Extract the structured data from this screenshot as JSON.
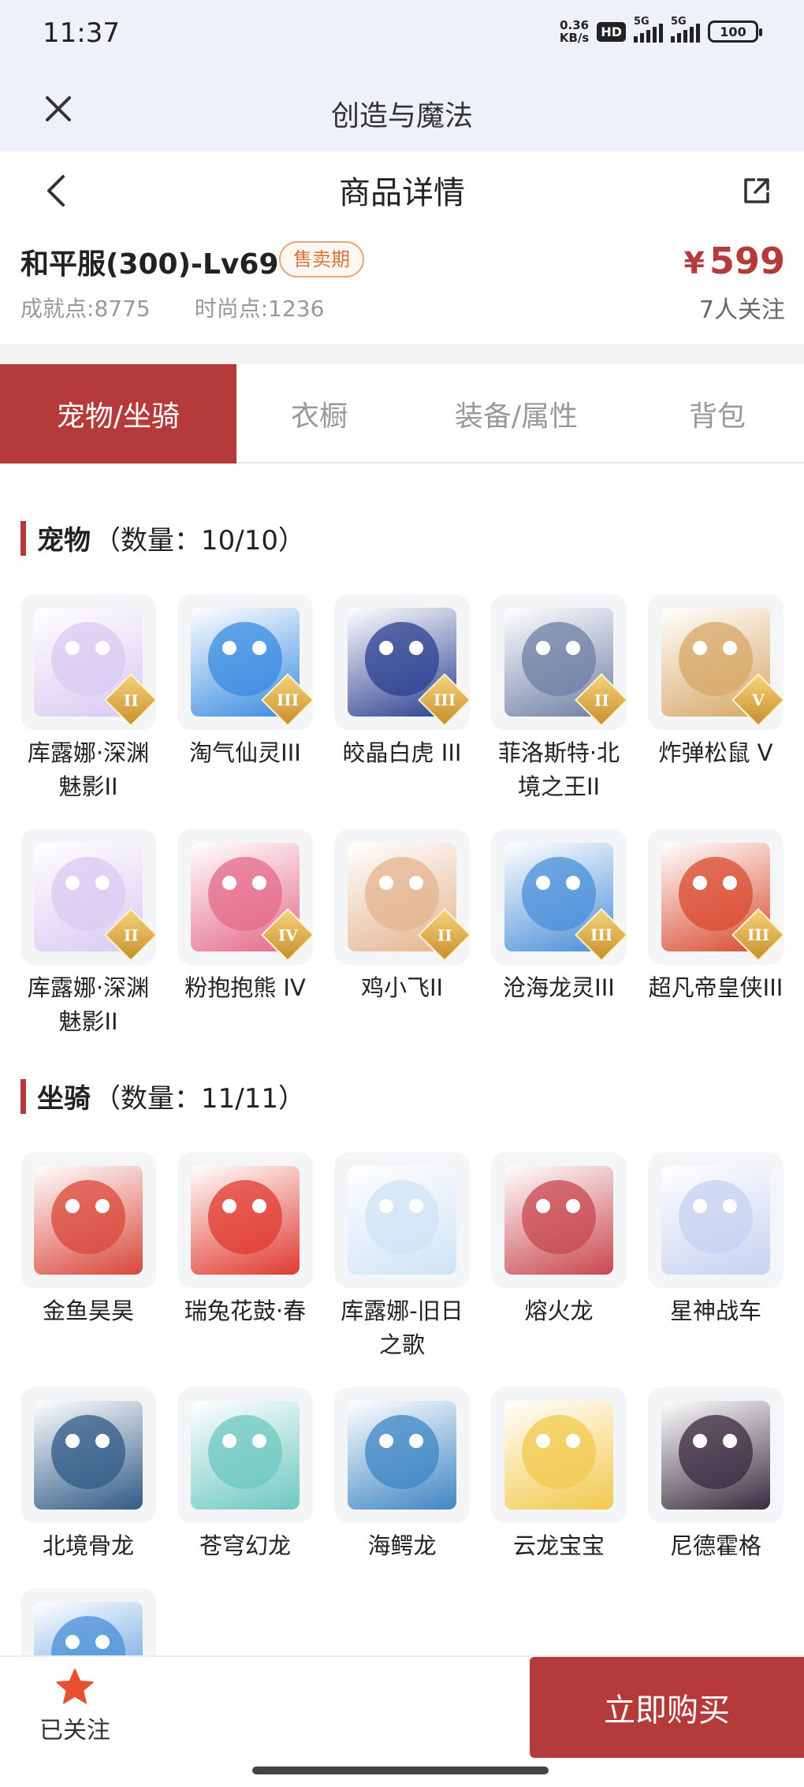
{
  "status": {
    "time": "11:37",
    "net_speed_top": "0.36",
    "net_speed_bottom": "KB/s",
    "hd": "HD",
    "sig1": "5G",
    "sig2": "5G",
    "battery": "100"
  },
  "app": {
    "title": "创造与魔法"
  },
  "nav": {
    "title": "商品详情"
  },
  "product": {
    "name": "和平服(300)-Lv69",
    "badge": "售卖期",
    "achievement_label": "成就点:",
    "achievement_value": "8775",
    "fashion_label": "时尚点:",
    "fashion_value": "1236",
    "currency": "¥",
    "price": "599",
    "followers": "7人关注"
  },
  "tabs": [
    "宠物/坐骑",
    "衣橱",
    "装备/属性",
    "背包"
  ],
  "pets": {
    "title": "宠物",
    "count": "（数量：10/10）",
    "items": [
      {
        "label": "库露娜·深渊魅影II",
        "rank": "II",
        "color": "#d9c9f2"
      },
      {
        "label": "淘气仙灵III",
        "rank": "III",
        "color": "#3a8be0"
      },
      {
        "label": "皎晶白虎 III",
        "rank": "III",
        "color": "#2b3f8f"
      },
      {
        "label": "菲洛斯特·北境之王II",
        "rank": "II",
        "color": "#6f7fa4"
      },
      {
        "label": "炸弹松鼠 V",
        "rank": "V",
        "color": "#d7a766"
      },
      {
        "label": "库露娜·深渊魅影II",
        "rank": "II",
        "color": "#d9c9f2"
      },
      {
        "label": "粉抱抱熊 IV",
        "rank": "IV",
        "color": "#e46a8a"
      },
      {
        "label": "鸡小飞II",
        "rank": "II",
        "color": "#e4b48f"
      },
      {
        "label": "沧海龙灵III",
        "rank": "III",
        "color": "#4a8fd8"
      },
      {
        "label": "超凡帝皇侠III",
        "rank": "III",
        "color": "#d94b2f"
      }
    ]
  },
  "mounts": {
    "title": "坐骑",
    "count": "（数量：11/11）",
    "items": [
      {
        "label": "金鱼昊昊",
        "color": "#d9473a"
      },
      {
        "label": "瑞兔花鼓·春",
        "color": "#e03a2f"
      },
      {
        "label": "库露娜-旧日之歌",
        "color": "#cfe3f5"
      },
      {
        "label": "熔火龙",
        "color": "#c8474f"
      },
      {
        "label": "星神战车",
        "color": "#c7d2f0"
      },
      {
        "label": "北境骨龙",
        "color": "#2f5a86"
      },
      {
        "label": "苍穹幻龙",
        "color": "#6ec7c0"
      },
      {
        "label": "海鳄龙",
        "color": "#3f86c4"
      },
      {
        "label": "云龙宝宝",
        "color": "#f2c94c"
      },
      {
        "label": "尼德霍格",
        "color": "#3a2a3e"
      },
      {
        "label": "",
        "color": "#4a8fd8"
      }
    ]
  },
  "bottom": {
    "follow_label": "已关注",
    "buy_label": "立即购买",
    "accent": "#b53b3b"
  }
}
